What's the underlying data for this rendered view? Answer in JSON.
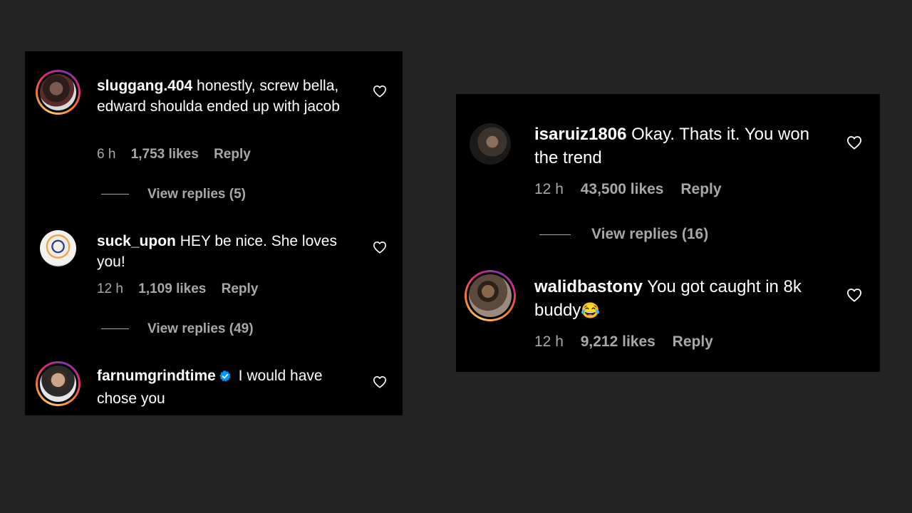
{
  "left_panel": {
    "comments": [
      {
        "username": "sluggang.404",
        "text": " honestly, screw bella, edward shoulda ended up with jacob",
        "time": "6 h",
        "likes": "1,753 likes",
        "reply": "Reply",
        "view_replies": "View replies (5)",
        "has_story_ring": true
      },
      {
        "username": "suck_upon",
        "text": " HEY be nice. She loves you!",
        "time": "12 h",
        "likes": "1,109 likes",
        "reply": "Reply",
        "view_replies": "View replies (49)",
        "has_story_ring": false
      },
      {
        "username": "farnumgrindtime",
        "text": " I would have chose you",
        "verified": true,
        "has_story_ring": true
      }
    ]
  },
  "right_panel": {
    "comments": [
      {
        "username": "isaruiz1806",
        "text": " Okay. Thats it. You won the trend",
        "time": "12 h",
        "likes": "43,500 likes",
        "reply": "Reply",
        "view_replies": "View replies (16)",
        "has_story_ring": false
      },
      {
        "username": "walidbastony",
        "text": " You got caught in 8k buddy",
        "emoji": "😂",
        "time": "12 h",
        "likes": "9,212 likes",
        "reply": "Reply",
        "has_story_ring": true
      }
    ]
  },
  "colors": {
    "page_bg": "#232323",
    "panel_bg": "#000000",
    "secondary_text": "#a8a8a8",
    "verified_blue": "#0095f6"
  },
  "icons": {
    "like": "heart-outline-icon",
    "verified": "verified-badge-icon"
  }
}
